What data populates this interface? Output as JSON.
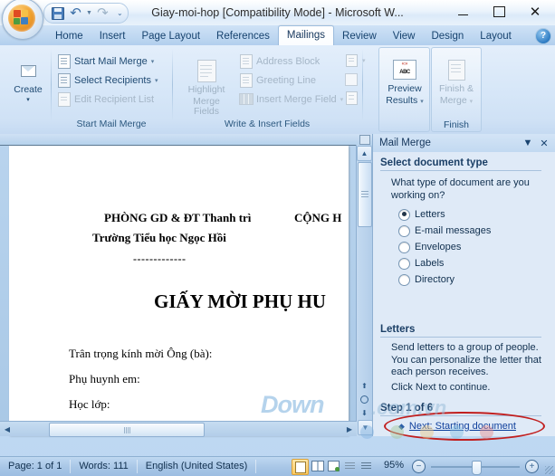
{
  "window": {
    "title": "Giay-moi-hop [Compatibility Mode]  -  Microsoft W...",
    "minimize": "—",
    "maximize": "□",
    "close": "✕"
  },
  "quick_access": {
    "save": "save-icon",
    "undo": "↺",
    "redo": "↻",
    "customize": "▾"
  },
  "tabs": [
    {
      "label": "Home",
      "active": false
    },
    {
      "label": "Insert",
      "active": false
    },
    {
      "label": "Page Layout",
      "active": false
    },
    {
      "label": "References",
      "active": false
    },
    {
      "label": "Mailings",
      "active": true
    },
    {
      "label": "Review",
      "active": false
    },
    {
      "label": "View",
      "active": false
    },
    {
      "label": "Design",
      "active": false
    },
    {
      "label": "Layout",
      "active": false
    }
  ],
  "help_button": "?",
  "ribbon": {
    "groups": [
      {
        "name": "Create",
        "label": "",
        "big_button": {
          "label": "Create",
          "caret": "▾"
        }
      },
      {
        "name": "Start Mail Merge",
        "label": "Start Mail Merge",
        "items": [
          {
            "label": "Start Mail Merge",
            "caret": "▾",
            "disabled": false
          },
          {
            "label": "Select Recipients",
            "caret": "▾",
            "disabled": false
          },
          {
            "label": "Edit Recipient List",
            "caret": "",
            "disabled": true
          }
        ]
      },
      {
        "name": "Write & Insert Fields",
        "label": "Write & Insert Fields",
        "big_button": {
          "label_line1": "Highlight",
          "label_line2": "Merge Fields"
        },
        "items": [
          {
            "label": "Address Block",
            "caret": "",
            "disabled": true
          },
          {
            "label": "Greeting Line",
            "caret": "",
            "disabled": true
          },
          {
            "label": "Insert Merge Field",
            "caret": "▾",
            "disabled": true
          }
        ]
      },
      {
        "name": "Preview Results",
        "label": "",
        "big_button": {
          "label_line1": "Preview",
          "label_line2": "Results",
          "caret": "▾",
          "badge": "ABC"
        }
      },
      {
        "name": "Finish",
        "label": "Finish",
        "big_button": {
          "label_line1": "Finish &",
          "label_line2": "Merge",
          "caret": "▾",
          "disabled": true
        }
      }
    ]
  },
  "document": {
    "line1": "PHÒNG GD & ĐT Thanh trì",
    "line2": "Trường Tiểu học Ngọc Hồi",
    "line3": "-------------",
    "line_right": "CỘNG H",
    "heading": "GIẤY MỜI PHỤ HU",
    "body1": "Trân trọng kính mời Ông (bà):",
    "body2": "Phụ huynh em:",
    "body3": "Học lớp:"
  },
  "task_pane": {
    "title": "Mail Merge",
    "dropdown_icon": "▼",
    "close_icon": "✕",
    "section_heading": "Select document type",
    "question": "What type of document are you working on?",
    "options": [
      {
        "label": "Letters",
        "selected": true
      },
      {
        "label": "E-mail messages",
        "selected": false
      },
      {
        "label": "Envelopes",
        "selected": false
      },
      {
        "label": "Labels",
        "selected": false
      },
      {
        "label": "Directory",
        "selected": false
      }
    ],
    "info_heading": "Letters",
    "info_text_1": "Send letters to a group of people. You can personalize the letter that each person receives.",
    "info_text_2": "Click Next to continue.",
    "step_label": "Step 1 of 6",
    "next_link": "Next: Starting document",
    "next_arrow": "◆"
  },
  "status_bar": {
    "page": "Page: 1 of 1",
    "words": "Words: 111",
    "language": "English (United States)",
    "zoom": "95%",
    "zoom_out": "−",
    "zoom_in": "+",
    "view_buttons": [
      {
        "name": "print-layout-view",
        "selected": true
      },
      {
        "name": "full-screen-reading-view",
        "selected": false
      },
      {
        "name": "web-layout-view",
        "selected": false
      },
      {
        "name": "outline-view",
        "selected": false
      },
      {
        "name": "draft-view",
        "selected": false
      }
    ]
  },
  "watermark": {
    "text1": "Down",
    "text2": ".com.vn"
  },
  "colors": {
    "accent": "#1f4a72",
    "highlight_ellipse": "#c11f1f",
    "link": "#10409c",
    "pane_bg": "#dfeaf7"
  }
}
